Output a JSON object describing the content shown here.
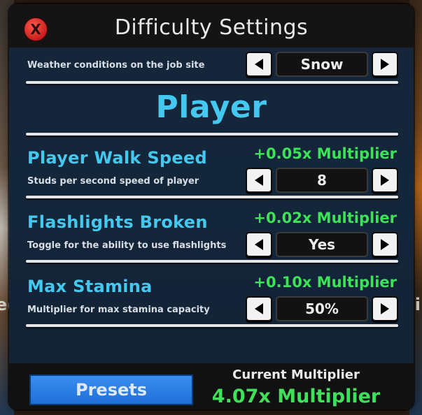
{
  "window": {
    "title": "Difficulty Settings",
    "close_label": "X"
  },
  "background": {
    "left_fragment": "ee",
    "right_fragment": "i"
  },
  "weather": {
    "description": "Weather conditions on the job site",
    "value": "Snow"
  },
  "section": {
    "title": "Player"
  },
  "settings": [
    {
      "name": "Player Walk Speed",
      "description": "Studs per second speed of player",
      "multiplier": "+0.05x Multiplier",
      "value": "8"
    },
    {
      "name": "Flashlights Broken",
      "description": "Toggle for the ability to use flashlights",
      "multiplier": "+0.02x Multiplier",
      "value": "Yes"
    },
    {
      "name": "Max Stamina",
      "description": "Multiplier for max stamina capacity",
      "multiplier": "+0.10x Multiplier",
      "value": "50%"
    }
  ],
  "footer": {
    "presets_label": "Presets",
    "current_label": "Current Multiplier",
    "current_value": "4.07x Multiplier"
  },
  "colors": {
    "accent_blue": "#44c8f0",
    "multiplier_green": "#3fe05a",
    "close_red": "#c81e1e",
    "presets_blue": "#2a7de6"
  }
}
